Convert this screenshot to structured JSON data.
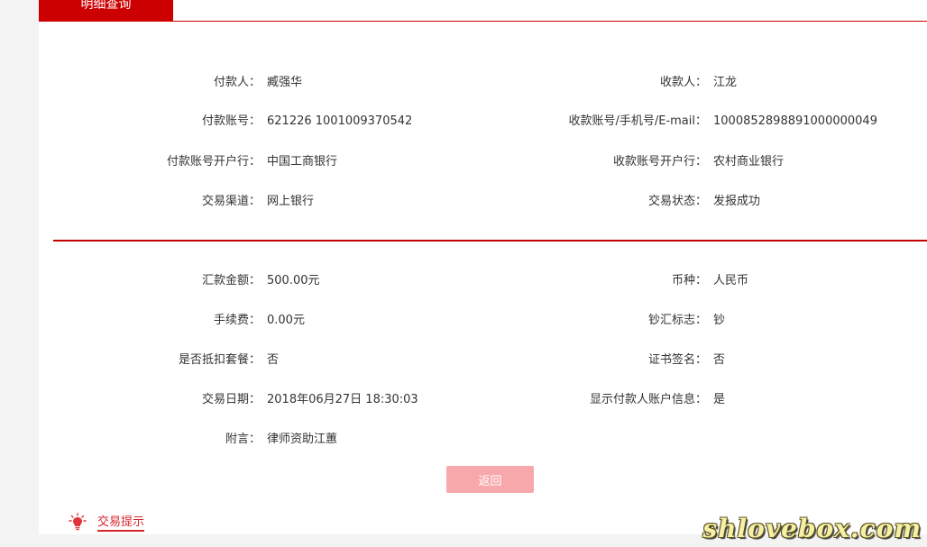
{
  "tab": {
    "label": "明细查询"
  },
  "payment_info": [
    {
      "left_label": "付款人：",
      "left_value": "臧强华",
      "right_label": "收款人：",
      "right_value": "江龙"
    },
    {
      "left_label": "付款账号：",
      "left_value": "621226 1001009370542",
      "right_label": "收款账号/手机号/E-mail：",
      "right_value": "1000852898891000000049"
    },
    {
      "left_label": "付款账号开户行：",
      "left_value": "中国工商银行",
      "right_label": "收款账号开户行：",
      "right_value": "农村商业银行"
    },
    {
      "left_label": "交易渠道：",
      "left_value": "网上银行",
      "right_label": "交易状态：",
      "right_value": "发报成功"
    }
  ],
  "transfer_info": [
    {
      "left_label": "汇款金额：",
      "left_value": "500.00元",
      "right_label": "币种：",
      "right_value": "人民币"
    },
    {
      "left_label": "手续费：",
      "left_value": "0.00元",
      "right_label": "钞汇标志：",
      "right_value": "钞"
    },
    {
      "left_label": "是否抵扣套餐：",
      "left_value": "否",
      "right_label": "证书签名：",
      "right_value": "否"
    },
    {
      "left_label": "交易日期：",
      "left_value": "2018年06月27日 18:30:03",
      "right_label": "显示付款人账户信息：",
      "right_value": "是"
    },
    {
      "left_label": "附言：",
      "left_value": "律师资助江蕙"
    }
  ],
  "back_button": {
    "label": "返回"
  },
  "tip": {
    "label": "交易提示",
    "icon": "lightbulb-icon"
  },
  "watermark": {
    "text": "shlovebox.com"
  },
  "colors": {
    "accent": "#cc0000",
    "button": "#f7a8aa",
    "tip": "#d9262d"
  }
}
